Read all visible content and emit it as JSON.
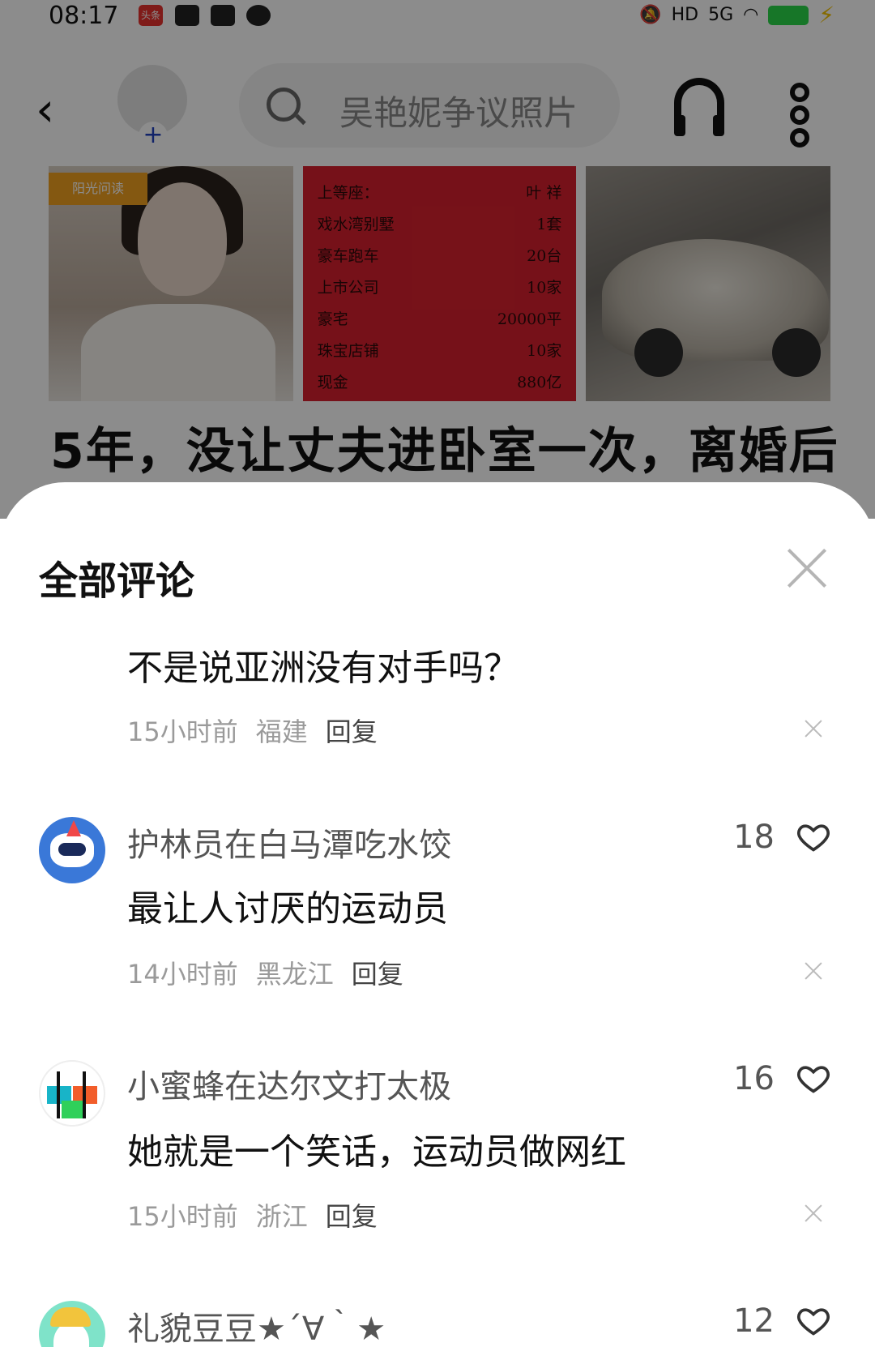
{
  "status_bar": {
    "time": "08:17",
    "app_badge": "头条",
    "network": "5G",
    "hd_label": "HD"
  },
  "top_nav": {
    "search_text": "吴艳妮争议照片"
  },
  "article": {
    "image_tag": "阳光问读",
    "list_rows": [
      {
        "item": "上等座：",
        "value": "叶 祥"
      },
      {
        "item": "戏水湾别墅",
        "value": "1套"
      },
      {
        "item": "豪车跑车",
        "value": "20台"
      },
      {
        "item": "上市公司",
        "value": "10家"
      },
      {
        "item": "豪宅",
        "value": "20000平"
      },
      {
        "item": "珠宝店铺",
        "value": "10家"
      },
      {
        "item": "现金",
        "value": "880亿"
      }
    ],
    "title": "5年，没让丈夫进卧室一次，离婚后"
  },
  "comments_panel": {
    "title": "全部评论",
    "comments": [
      {
        "username": "",
        "text": "不是说亚洲没有对手吗？",
        "time": "15小时前",
        "location": "福建",
        "reply_label": "回复",
        "likes": ""
      },
      {
        "username": "护林员在白马潭吃水饺",
        "text": "最让人讨厌的运动员",
        "time": "14小时前",
        "location": "黑龙江",
        "reply_label": "回复",
        "likes": "18"
      },
      {
        "username": "小蜜蜂在达尔文打太极",
        "text": "她就是一个笑话，运动员做网红",
        "time": "15小时前",
        "location": "浙江",
        "reply_label": "回复",
        "likes": "16"
      },
      {
        "username": "礼貌豆豆★´∀｀★",
        "text": "",
        "time": "",
        "location": "",
        "reply_label": "",
        "likes": "12"
      }
    ]
  },
  "colors": {
    "overlay": "#000000",
    "battery": "#2bd74a",
    "sheet_bg": "#ffffff",
    "meta_gray": "#9a9a9a"
  }
}
